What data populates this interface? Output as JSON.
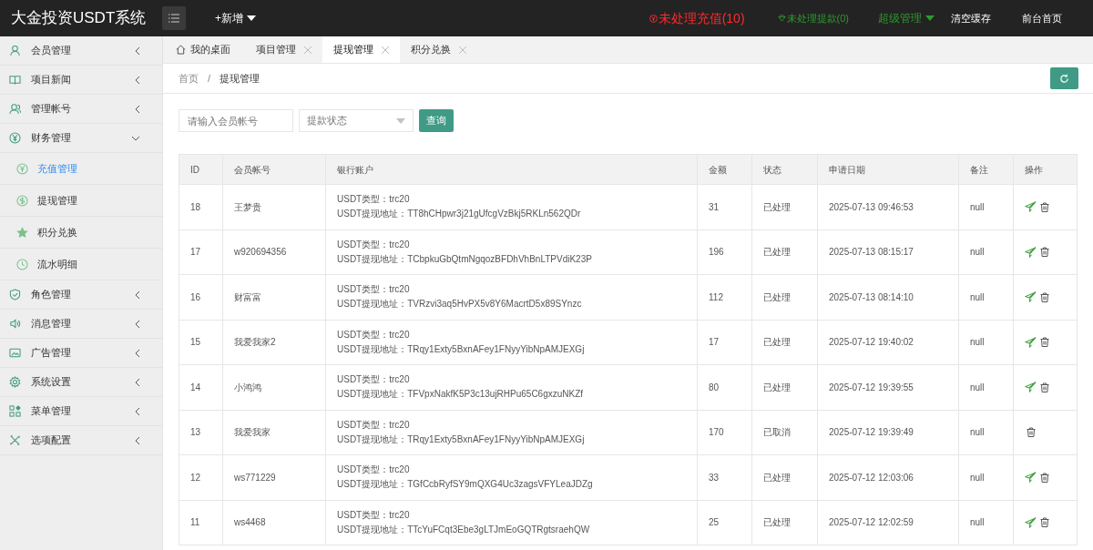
{
  "header": {
    "title": "大金投资USDT系统",
    "add_menu": "+新增",
    "pending_recharge": "未处理充值(10)",
    "pending_withdraw": "未处理提款(0)",
    "admin_menu": "超级管理",
    "clear_cache": "清空缓存",
    "front_home": "前台首页"
  },
  "sidebar": {
    "items": [
      {
        "label": "会员管理",
        "expanded": false
      },
      {
        "label": "项目新闻",
        "expanded": false
      },
      {
        "label": "管理帐号",
        "expanded": false
      },
      {
        "label": "财务管理",
        "expanded": true,
        "children": [
          {
            "label": "充值管理",
            "selected": true
          },
          {
            "label": "提现管理",
            "selected": false
          },
          {
            "label": "积分兑换",
            "selected": false
          },
          {
            "label": "流水明细",
            "selected": false
          }
        ]
      },
      {
        "label": "角色管理",
        "expanded": false
      },
      {
        "label": "消息管理",
        "expanded": false
      },
      {
        "label": "广告管理",
        "expanded": false
      },
      {
        "label": "系统设置",
        "expanded": false
      },
      {
        "label": "菜单管理",
        "expanded": false
      },
      {
        "label": "选项配置",
        "expanded": false
      }
    ]
  },
  "tabs": [
    {
      "label": "我的桌面",
      "kind": "home",
      "selected": false
    },
    {
      "label": "项目管理",
      "kind": "closable",
      "selected": false
    },
    {
      "label": "提现管理",
      "kind": "closable",
      "selected": true
    },
    {
      "label": "积分兑换",
      "kind": "closable",
      "selected": false
    }
  ],
  "breadcrumb": [
    "首页",
    "/",
    "提现管理"
  ],
  "search": {
    "account_placeholder": "请输入会员帐号",
    "status_placeholder": "提款状态",
    "query_button": "查询"
  },
  "table": {
    "columns": [
      "ID",
      "会员帐号",
      "银行账户",
      "金额",
      "状态",
      "申请日期",
      "备注",
      "操作"
    ],
    "rows": [
      {
        "id": "18",
        "account": "王梦贵",
        "usdt_type": "USDT类型：trc20",
        "usdt_address": "USDT提现地址：TT8hCHpwr3j21gUfcgVzBkj5RKLn562QDr",
        "amount": "31",
        "status": "已处理",
        "date": "2025-07-13 09:46:53",
        "note": "null",
        "can_send": true
      },
      {
        "id": "17",
        "account": "w920694356",
        "usdt_type": "USDT类型：trc20",
        "usdt_address": "USDT提现地址：TCbpkuGbQtmNgqozBFDhVhBnLTPVdiK23P",
        "amount": "196",
        "status": "已处理",
        "date": "2025-07-13 08:15:17",
        "note": "null",
        "can_send": true
      },
      {
        "id": "16",
        "account": "财富富",
        "usdt_type": "USDT类型：trc20",
        "usdt_address": "USDT提现地址：TVRzvi3aq5HvPX5v8Y6MacrtD5x89SYnzc",
        "amount": "112",
        "status": "已处理",
        "date": "2025-07-13 08:14:10",
        "note": "null",
        "can_send": true
      },
      {
        "id": "15",
        "account": "我爱我家2",
        "usdt_type": "USDT类型：trc20",
        "usdt_address": "USDT提现地址：TRqy1Exty5BxnAFey1FNyyYibNpAMJEXGj",
        "amount": "17",
        "status": "已处理",
        "date": "2025-07-12 19:40:02",
        "note": "null",
        "can_send": true
      },
      {
        "id": "14",
        "account": "小鸿鸿",
        "usdt_type": "USDT类型：trc20",
        "usdt_address": "USDT提现地址：TFVpxNakfK5P3c13ujRHPu65C6gxzuNKZf",
        "amount": "80",
        "status": "已处理",
        "date": "2025-07-12 19:39:55",
        "note": "null",
        "can_send": true
      },
      {
        "id": "13",
        "account": "我爱我家",
        "usdt_type": "USDT类型：trc20",
        "usdt_address": "USDT提现地址：TRqy1Exty5BxnAFey1FNyyYibNpAMJEXGj",
        "amount": "170",
        "status": "已取消",
        "date": "2025-07-12 19:39:49",
        "note": "null",
        "can_send": false
      },
      {
        "id": "12",
        "account": "ws771229",
        "usdt_type": "USDT类型：trc20",
        "usdt_address": "USDT提现地址：TGfCcbRyfSY9mQXG4Uc3zagsVFYLeaJDZg",
        "amount": "33",
        "status": "已处理",
        "date": "2025-07-12 12:03:06",
        "note": "null",
        "can_send": true
      },
      {
        "id": "11",
        "account": "ws4468",
        "usdt_type": "USDT类型：trc20",
        "usdt_address": "USDT提现地址：TTcYuFCqt3Ebe3gLTJmEoGQTRgtsraehQW",
        "amount": "25",
        "status": "已处理",
        "date": "2025-07-12 12:02:59",
        "note": "null",
        "can_send": true
      }
    ]
  }
}
